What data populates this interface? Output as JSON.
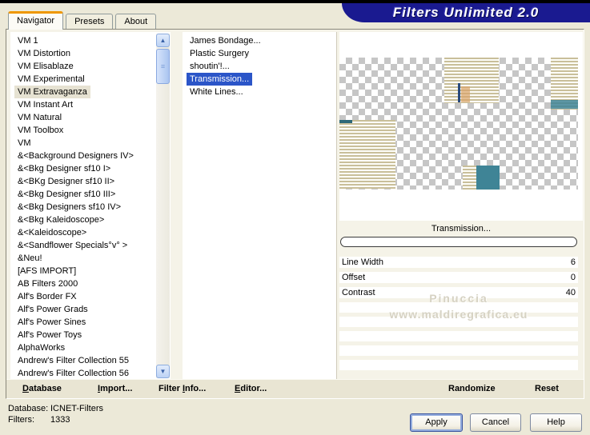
{
  "window": {
    "banner_title": "Filters Unlimited 2.0"
  },
  "tabs": {
    "items": [
      "Navigator",
      "Presets",
      "About"
    ],
    "active": "Navigator"
  },
  "category_list": {
    "selected": "VM Extravaganza",
    "items": [
      "VM 1",
      "VM Distortion",
      "VM Elisablaze",
      "VM Experimental",
      "VM Extravaganza",
      "VM Instant Art",
      "VM Natural",
      "VM Toolbox",
      "VM",
      "&<Background Designers IV>",
      "&<Bkg Designer sf10 I>",
      "&<BKg Designer sf10 II>",
      "&<Bkg Designer sf10 III>",
      "&<Bkg Designers sf10 IV>",
      "&<Bkg Kaleidoscope>",
      "&<Kaleidoscope>",
      "&<Sandflower Specials°v° >",
      "&Neu!",
      "[AFS IMPORT]",
      "AB Filters 2000",
      "Alf's Border FX",
      "Alf's Power Grads",
      "Alf's Power Sines",
      "Alf's Power Toys",
      "AlphaWorks",
      "Andrew's Filter Collection 55",
      "Andrew's Filter Collection 56"
    ]
  },
  "filter_list": {
    "selected": "Transmission...",
    "items": [
      "James Bondage...",
      "Plastic Surgery",
      "shoutin'!...",
      "Transmission...",
      "White Lines..."
    ]
  },
  "preview": {
    "caption": "Transmission..."
  },
  "parameters": {
    "rows": [
      {
        "label": "Line Width",
        "value": "6"
      },
      {
        "label": "Offset",
        "value": "0"
      },
      {
        "label": "Contrast",
        "value": "40"
      }
    ],
    "empty_rows": 5
  },
  "watermark": {
    "line1": "Pinuccia",
    "line2": "www.maldiregrafica.eu"
  },
  "toolbar": {
    "database": {
      "pre": "",
      "key": "D",
      "post": "atabase"
    },
    "import": {
      "pre": "",
      "key": "I",
      "post": "mport..."
    },
    "filter_info": {
      "pre": "Filter ",
      "key": "I",
      "post": "nfo..."
    },
    "editor": {
      "pre": "",
      "key": "E",
      "post": "ditor..."
    },
    "randomize": "Randomize",
    "reset": "Reset"
  },
  "status": {
    "database_label": "Database:",
    "database_value": "ICNET-Filters",
    "filters_label": "Filters:",
    "filters_value": "1333"
  },
  "buttons": {
    "apply": "Apply",
    "cancel": "Cancel",
    "help": "Help"
  },
  "colors": {
    "banner_navy": "#1a1a90",
    "selection_blue": "#2b55c8",
    "category_selected_bg": "#e6e2d2",
    "tab_accent_orange": "#ef9700",
    "stripe_tan": "#c9bf9a",
    "teal": "#3f8496",
    "checker_gray": "#c6c6c6",
    "dialog_bg": "#ece9d8"
  }
}
